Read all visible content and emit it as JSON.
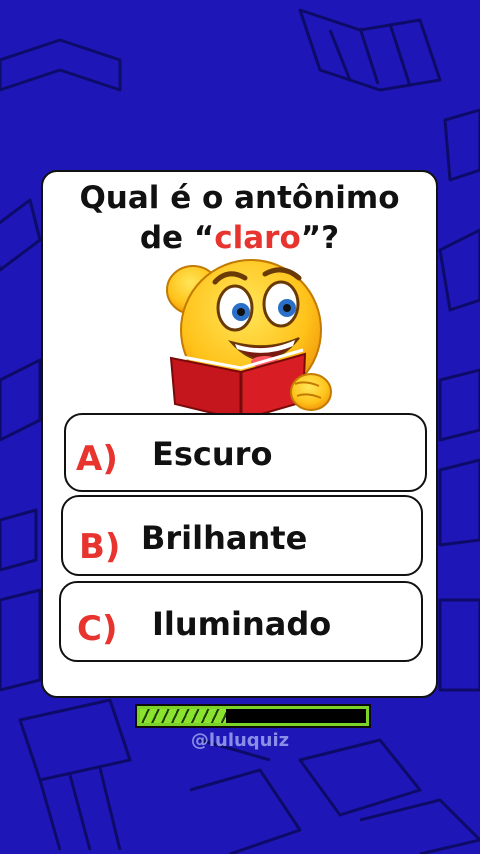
{
  "colors": {
    "background": "#1f16b8",
    "accent": "#e8342f",
    "progress": "#7dd22a"
  },
  "question": {
    "before": "Qual é o antônimo",
    "line2_prefix": "de “",
    "highlight": "claro",
    "line2_suffix": "”?"
  },
  "illustration": "smiling-emoji-reading-book-icon",
  "options": [
    {
      "letter": "A)",
      "text": "Escuro"
    },
    {
      "letter": "B)",
      "text": "Brilhante"
    },
    {
      "letter": "C)",
      "text": "Iluminado"
    }
  ],
  "timer": {
    "progress": 0.38
  },
  "handle": "@luluquiz"
}
